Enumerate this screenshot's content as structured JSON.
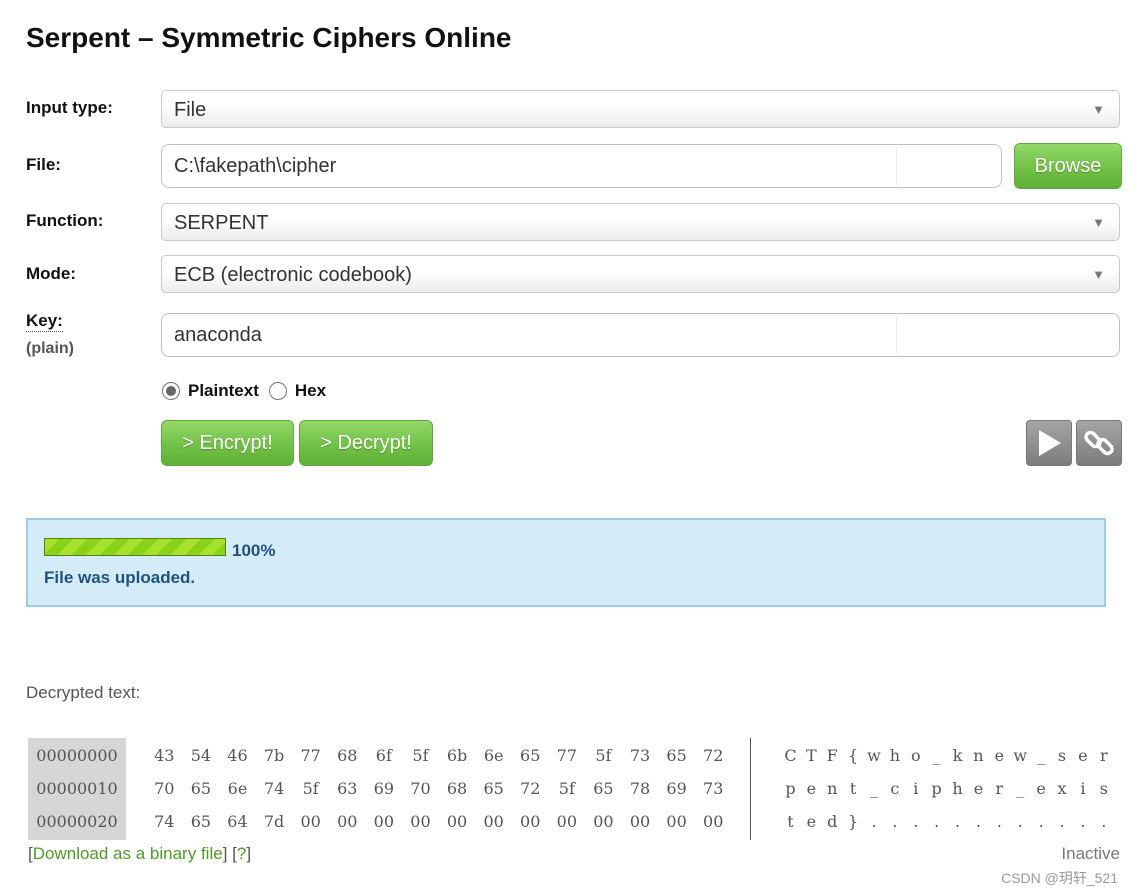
{
  "title": "Serpent – Symmetric Ciphers Online",
  "form": {
    "input_type": {
      "label": "Input type:",
      "value": "File"
    },
    "file": {
      "label": "File:",
      "value": "C:\\fakepath\\cipher",
      "browse_label": "Browse"
    },
    "function": {
      "label": "Function:",
      "value": "SERPENT"
    },
    "mode": {
      "label": "Mode:",
      "value": "ECB (electronic codebook)"
    },
    "key": {
      "label": "Key:",
      "sublabel": "(plain)",
      "value": "anaconda"
    },
    "key_format": {
      "plaintext_label": "Plaintext",
      "hex_label": "Hex",
      "selected": "Plaintext"
    },
    "encrypt_label": "> Encrypt!",
    "decrypt_label": "> Decrypt!"
  },
  "status": {
    "progress_percent": 100,
    "progress_text": "100%",
    "message": "File was uploaded."
  },
  "output": {
    "label": "Decrypted text:",
    "rows": [
      {
        "offset": "00000000",
        "hex": [
          "43",
          "54",
          "46",
          "7b",
          "77",
          "68",
          "6f",
          "5f",
          "6b",
          "6e",
          "65",
          "77",
          "5f",
          "73",
          "65",
          "72"
        ],
        "text": [
          "C",
          "T",
          "F",
          "{",
          "w",
          "h",
          "o",
          "_",
          "k",
          "n",
          "e",
          "w",
          "_",
          "s",
          "e",
          "r"
        ]
      },
      {
        "offset": "00000010",
        "hex": [
          "70",
          "65",
          "6e",
          "74",
          "5f",
          "63",
          "69",
          "70",
          "68",
          "65",
          "72",
          "5f",
          "65",
          "78",
          "69",
          "73"
        ],
        "text": [
          "p",
          "e",
          "n",
          "t",
          "_",
          "c",
          "i",
          "p",
          "h",
          "e",
          "r",
          "_",
          "e",
          "x",
          "i",
          "s"
        ]
      },
      {
        "offset": "00000020",
        "hex": [
          "74",
          "65",
          "64",
          "7d",
          "00",
          "00",
          "00",
          "00",
          "00",
          "00",
          "00",
          "00",
          "00",
          "00",
          "00",
          "00"
        ],
        "text": [
          "t",
          "e",
          "d",
          "}",
          ".",
          ".",
          ".",
          ".",
          ".",
          ".",
          ".",
          ".",
          ".",
          ".",
          ".",
          "."
        ]
      }
    ],
    "download_open": "[",
    "download_label": "Download as a binary file",
    "download_mid": "] [",
    "help_label": "?",
    "download_close": "]",
    "state": "Inactive"
  },
  "watermark": "CSDN @玥轩_521"
}
